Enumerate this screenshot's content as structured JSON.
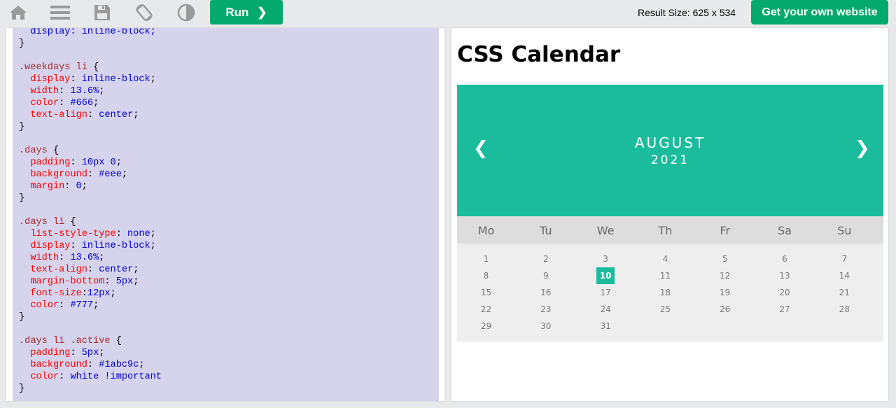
{
  "toolbar": {
    "icons": [
      "home-icon",
      "menu-icon",
      "save-icon",
      "rotate-icon",
      "contrast-icon"
    ],
    "run_label": "Run",
    "run_chevron": "❯",
    "result_size": "Result Size: 625 x 534",
    "own_site_label": "Get your own website"
  },
  "colors": {
    "accent_green": "#04aa6d",
    "calendar_teal": "#1abc9c",
    "code_background": "#d6d3ec",
    "selector": "#a52a2a",
    "property": "#ff0000",
    "value": "#0000cd"
  },
  "code": {
    "lines": [
      [
        {
          "t": "  display: inline-block;",
          "c": "val"
        }
      ],
      [
        {
          "t": "}",
          "c": "punc"
        }
      ],
      [],
      [
        {
          "t": ".weekdays li ",
          "c": "sel"
        },
        {
          "t": "{",
          "c": "punc"
        }
      ],
      [
        {
          "t": "  display",
          "c": "prop"
        },
        {
          "t": ": ",
          "c": "punc"
        },
        {
          "t": "inline-block",
          "c": "val"
        },
        {
          "t": ";",
          "c": "punc"
        }
      ],
      [
        {
          "t": "  width",
          "c": "prop"
        },
        {
          "t": ": ",
          "c": "punc"
        },
        {
          "t": "13.6%",
          "c": "val"
        },
        {
          "t": ";",
          "c": "punc"
        }
      ],
      [
        {
          "t": "  color",
          "c": "prop"
        },
        {
          "t": ": ",
          "c": "punc"
        },
        {
          "t": "#666",
          "c": "val"
        },
        {
          "t": ";",
          "c": "punc"
        }
      ],
      [
        {
          "t": "  text-align",
          "c": "prop"
        },
        {
          "t": ": ",
          "c": "punc"
        },
        {
          "t": "center",
          "c": "val"
        },
        {
          "t": ";",
          "c": "punc"
        }
      ],
      [
        {
          "t": "}",
          "c": "punc"
        }
      ],
      [],
      [
        {
          "t": ".days ",
          "c": "sel"
        },
        {
          "t": "{",
          "c": "punc"
        }
      ],
      [
        {
          "t": "  padding",
          "c": "prop"
        },
        {
          "t": ": ",
          "c": "punc"
        },
        {
          "t": "10px 0",
          "c": "val"
        },
        {
          "t": ";",
          "c": "punc"
        }
      ],
      [
        {
          "t": "  background",
          "c": "prop"
        },
        {
          "t": ": ",
          "c": "punc"
        },
        {
          "t": "#eee",
          "c": "val"
        },
        {
          "t": ";",
          "c": "punc"
        }
      ],
      [
        {
          "t": "  margin",
          "c": "prop"
        },
        {
          "t": ": ",
          "c": "punc"
        },
        {
          "t": "0",
          "c": "val"
        },
        {
          "t": ";",
          "c": "punc"
        }
      ],
      [
        {
          "t": "}",
          "c": "punc"
        }
      ],
      [],
      [
        {
          "t": ".days li ",
          "c": "sel"
        },
        {
          "t": "{",
          "c": "punc"
        }
      ],
      [
        {
          "t": "  list-style-type",
          "c": "prop"
        },
        {
          "t": ": ",
          "c": "punc"
        },
        {
          "t": "none",
          "c": "val"
        },
        {
          "t": ";",
          "c": "punc"
        }
      ],
      [
        {
          "t": "  display",
          "c": "prop"
        },
        {
          "t": ": ",
          "c": "punc"
        },
        {
          "t": "inline-block",
          "c": "val"
        },
        {
          "t": ";",
          "c": "punc"
        }
      ],
      [
        {
          "t": "  width",
          "c": "prop"
        },
        {
          "t": ": ",
          "c": "punc"
        },
        {
          "t": "13.6%",
          "c": "val"
        },
        {
          "t": ";",
          "c": "punc"
        }
      ],
      [
        {
          "t": "  text-align",
          "c": "prop"
        },
        {
          "t": ": ",
          "c": "punc"
        },
        {
          "t": "center",
          "c": "val"
        },
        {
          "t": ";",
          "c": "punc"
        }
      ],
      [
        {
          "t": "  margin-bottom",
          "c": "prop"
        },
        {
          "t": ": ",
          "c": "punc"
        },
        {
          "t": "5px",
          "c": "val"
        },
        {
          "t": ";",
          "c": "punc"
        }
      ],
      [
        {
          "t": "  font-size",
          "c": "prop"
        },
        {
          "t": ":",
          "c": "punc"
        },
        {
          "t": "12px",
          "c": "val"
        },
        {
          "t": ";",
          "c": "punc"
        }
      ],
      [
        {
          "t": "  color",
          "c": "prop"
        },
        {
          "t": ": ",
          "c": "punc"
        },
        {
          "t": "#777",
          "c": "val"
        },
        {
          "t": ";",
          "c": "punc"
        }
      ],
      [
        {
          "t": "}",
          "c": "punc"
        }
      ],
      [],
      [
        {
          "t": ".days li .active ",
          "c": "sel"
        },
        {
          "t": "{",
          "c": "punc"
        }
      ],
      [
        {
          "t": "  padding",
          "c": "prop"
        },
        {
          "t": ": ",
          "c": "punc"
        },
        {
          "t": "5px",
          "c": "val"
        },
        {
          "t": ";",
          "c": "punc"
        }
      ],
      [
        {
          "t": "  background",
          "c": "prop"
        },
        {
          "t": ": ",
          "c": "punc"
        },
        {
          "t": "#1abc9c",
          "c": "val"
        },
        {
          "t": ";",
          "c": "punc"
        }
      ],
      [
        {
          "t": "  color",
          "c": "prop"
        },
        {
          "t": ": ",
          "c": "punc"
        },
        {
          "t": "white !important",
          "c": "val"
        }
      ],
      [
        {
          "t": "}",
          "c": "punc"
        }
      ]
    ]
  },
  "result": {
    "title": "CSS Calendar",
    "month": {
      "prev": "❮",
      "next": "❯",
      "name": "AUGUST",
      "year": "2021"
    },
    "weekdays": [
      "Mo",
      "Tu",
      "We",
      "Th",
      "Fr",
      "Sa",
      "Su"
    ],
    "days": [
      "1",
      "2",
      "3",
      "4",
      "5",
      "6",
      "7",
      "8",
      "9",
      "10",
      "11",
      "12",
      "13",
      "14",
      "15",
      "16",
      "17",
      "18",
      "19",
      "20",
      "21",
      "22",
      "23",
      "24",
      "25",
      "26",
      "27",
      "28",
      "29",
      "30",
      "31"
    ],
    "active_day": "10"
  }
}
